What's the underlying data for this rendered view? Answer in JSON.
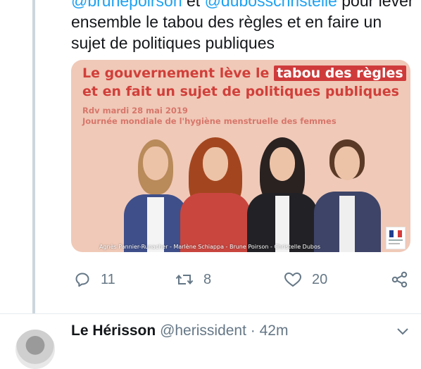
{
  "tweet": {
    "mention_a": "@brunepoirson",
    "conjunction": " et ",
    "mention_b": "@dubosschristelle",
    "line1_tail": " pour lever",
    "text_rest": "ensemble le tabou des règles et en faire un sujet de politiques publiques"
  },
  "card": {
    "headline_part1": "Le gouvernement lève le ",
    "headline_highlight": "tabou des règles",
    "headline_part2": "et en fait un sujet de politiques publiques",
    "event_date": "Rdv mardi 28 mai 2019",
    "event_title": "Journée mondiale de l'hygiène menstruelle des femmes",
    "names_caption": "Agnès Pannier-Runacher - Marlène Schiappa - Brune Poirson - Christelle Dubos",
    "colors": {
      "background": "#f0c9b8",
      "headline": "#d13f3a",
      "highlight": "#cf3b3b",
      "event_text": "#d7766a"
    }
  },
  "actions": {
    "reply": {
      "icon": "reply-icon",
      "count": "11"
    },
    "retweet": {
      "icon": "retweet-icon",
      "count": "8"
    },
    "like": {
      "icon": "heart-icon",
      "count": "20"
    },
    "share": {
      "icon": "share-icon"
    }
  },
  "next_tweet": {
    "display_name": "Le Hérisson",
    "handle": "@herissident",
    "separator": " · ",
    "time": "42m",
    "menu_icon": "chevron-down-icon"
  },
  "colors": {
    "text": "#14171a",
    "secondary": "#657786",
    "link": "#1da1f2",
    "thread_line": "#ccd6dd"
  }
}
